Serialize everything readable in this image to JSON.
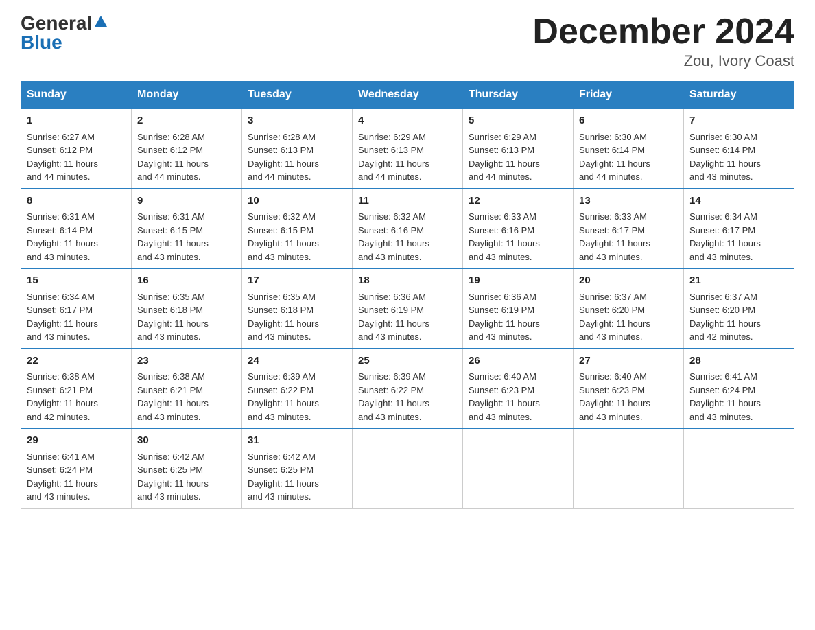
{
  "logo": {
    "general": "General",
    "blue": "Blue"
  },
  "title": {
    "month_year": "December 2024",
    "location": "Zou, Ivory Coast"
  },
  "headers": [
    "Sunday",
    "Monday",
    "Tuesday",
    "Wednesday",
    "Thursday",
    "Friday",
    "Saturday"
  ],
  "weeks": [
    [
      {
        "day": "1",
        "sunrise": "6:27 AM",
        "sunset": "6:12 PM",
        "daylight": "11 hours and 44 minutes."
      },
      {
        "day": "2",
        "sunrise": "6:28 AM",
        "sunset": "6:12 PM",
        "daylight": "11 hours and 44 minutes."
      },
      {
        "day": "3",
        "sunrise": "6:28 AM",
        "sunset": "6:13 PM",
        "daylight": "11 hours and 44 minutes."
      },
      {
        "day": "4",
        "sunrise": "6:29 AM",
        "sunset": "6:13 PM",
        "daylight": "11 hours and 44 minutes."
      },
      {
        "day": "5",
        "sunrise": "6:29 AM",
        "sunset": "6:13 PM",
        "daylight": "11 hours and 44 minutes."
      },
      {
        "day": "6",
        "sunrise": "6:30 AM",
        "sunset": "6:14 PM",
        "daylight": "11 hours and 44 minutes."
      },
      {
        "day": "7",
        "sunrise": "6:30 AM",
        "sunset": "6:14 PM",
        "daylight": "11 hours and 43 minutes."
      }
    ],
    [
      {
        "day": "8",
        "sunrise": "6:31 AM",
        "sunset": "6:14 PM",
        "daylight": "11 hours and 43 minutes."
      },
      {
        "day": "9",
        "sunrise": "6:31 AM",
        "sunset": "6:15 PM",
        "daylight": "11 hours and 43 minutes."
      },
      {
        "day": "10",
        "sunrise": "6:32 AM",
        "sunset": "6:15 PM",
        "daylight": "11 hours and 43 minutes."
      },
      {
        "day": "11",
        "sunrise": "6:32 AM",
        "sunset": "6:16 PM",
        "daylight": "11 hours and 43 minutes."
      },
      {
        "day": "12",
        "sunrise": "6:33 AM",
        "sunset": "6:16 PM",
        "daylight": "11 hours and 43 minutes."
      },
      {
        "day": "13",
        "sunrise": "6:33 AM",
        "sunset": "6:17 PM",
        "daylight": "11 hours and 43 minutes."
      },
      {
        "day": "14",
        "sunrise": "6:34 AM",
        "sunset": "6:17 PM",
        "daylight": "11 hours and 43 minutes."
      }
    ],
    [
      {
        "day": "15",
        "sunrise": "6:34 AM",
        "sunset": "6:17 PM",
        "daylight": "11 hours and 43 minutes."
      },
      {
        "day": "16",
        "sunrise": "6:35 AM",
        "sunset": "6:18 PM",
        "daylight": "11 hours and 43 minutes."
      },
      {
        "day": "17",
        "sunrise": "6:35 AM",
        "sunset": "6:18 PM",
        "daylight": "11 hours and 43 minutes."
      },
      {
        "day": "18",
        "sunrise": "6:36 AM",
        "sunset": "6:19 PM",
        "daylight": "11 hours and 43 minutes."
      },
      {
        "day": "19",
        "sunrise": "6:36 AM",
        "sunset": "6:19 PM",
        "daylight": "11 hours and 43 minutes."
      },
      {
        "day": "20",
        "sunrise": "6:37 AM",
        "sunset": "6:20 PM",
        "daylight": "11 hours and 43 minutes."
      },
      {
        "day": "21",
        "sunrise": "6:37 AM",
        "sunset": "6:20 PM",
        "daylight": "11 hours and 42 minutes."
      }
    ],
    [
      {
        "day": "22",
        "sunrise": "6:38 AM",
        "sunset": "6:21 PM",
        "daylight": "11 hours and 42 minutes."
      },
      {
        "day": "23",
        "sunrise": "6:38 AM",
        "sunset": "6:21 PM",
        "daylight": "11 hours and 43 minutes."
      },
      {
        "day": "24",
        "sunrise": "6:39 AM",
        "sunset": "6:22 PM",
        "daylight": "11 hours and 43 minutes."
      },
      {
        "day": "25",
        "sunrise": "6:39 AM",
        "sunset": "6:22 PM",
        "daylight": "11 hours and 43 minutes."
      },
      {
        "day": "26",
        "sunrise": "6:40 AM",
        "sunset": "6:23 PM",
        "daylight": "11 hours and 43 minutes."
      },
      {
        "day": "27",
        "sunrise": "6:40 AM",
        "sunset": "6:23 PM",
        "daylight": "11 hours and 43 minutes."
      },
      {
        "day": "28",
        "sunrise": "6:41 AM",
        "sunset": "6:24 PM",
        "daylight": "11 hours and 43 minutes."
      }
    ],
    [
      {
        "day": "29",
        "sunrise": "6:41 AM",
        "sunset": "6:24 PM",
        "daylight": "11 hours and 43 minutes."
      },
      {
        "day": "30",
        "sunrise": "6:42 AM",
        "sunset": "6:25 PM",
        "daylight": "11 hours and 43 minutes."
      },
      {
        "day": "31",
        "sunrise": "6:42 AM",
        "sunset": "6:25 PM",
        "daylight": "11 hours and 43 minutes."
      },
      null,
      null,
      null,
      null
    ]
  ],
  "labels": {
    "sunrise": "Sunrise:",
    "sunset": "Sunset:",
    "daylight": "Daylight:"
  }
}
